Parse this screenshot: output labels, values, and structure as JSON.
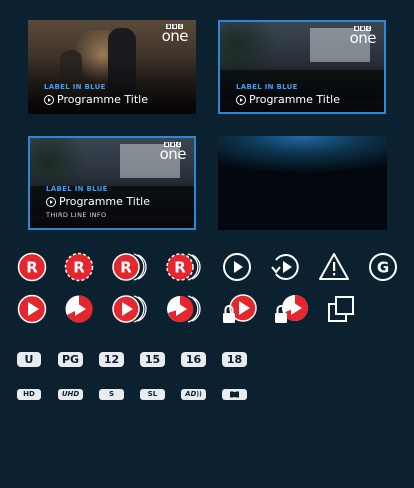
{
  "cards": [
    {
      "label": "LABEL IN BLUE",
      "title": "Programme Title",
      "channel_logo": "bbc-one-logo",
      "selected": false
    },
    {
      "label": "LABEL IN BLUE",
      "title": "Programme Title",
      "channel_logo": "bbc-one-logo",
      "selected": true
    },
    {
      "label": "LABEL IN BLUE",
      "title": "Programme Title",
      "third_line": "THIRD LINE INFO",
      "channel_logo": "bbc-one-logo",
      "selected": true
    }
  ],
  "logo": {
    "blocks": [
      "B",
      "B",
      "C"
    ],
    "channel": "one"
  },
  "icons_row1": [
    "recording-icon",
    "recording-dashed-icon",
    "series-recording-icon",
    "series-recording-dashed-icon",
    "play-outline-icon",
    "replay-outline-icon",
    "warning-icon",
    "guidance-icon"
  ],
  "icon_texts": {
    "recording": "R",
    "guidance": "G"
  },
  "icons_row2": [
    "play-red-icon",
    "play-resume-icon",
    "play-series-icon",
    "play-series-dashed-icon",
    "play-locked-icon",
    "play-resume-locked-icon",
    "copy-icon"
  ],
  "ratings": [
    "U",
    "PG",
    "12",
    "15",
    "16",
    "18"
  ],
  "format_badges": [
    "HD",
    "UHD",
    "S",
    "SL",
    "AD",
    "dolby"
  ],
  "colors": {
    "red": "#e5262d",
    "blue": "#2f86d8",
    "label_blue": "#3d9df5",
    "background": "#0b2130"
  }
}
